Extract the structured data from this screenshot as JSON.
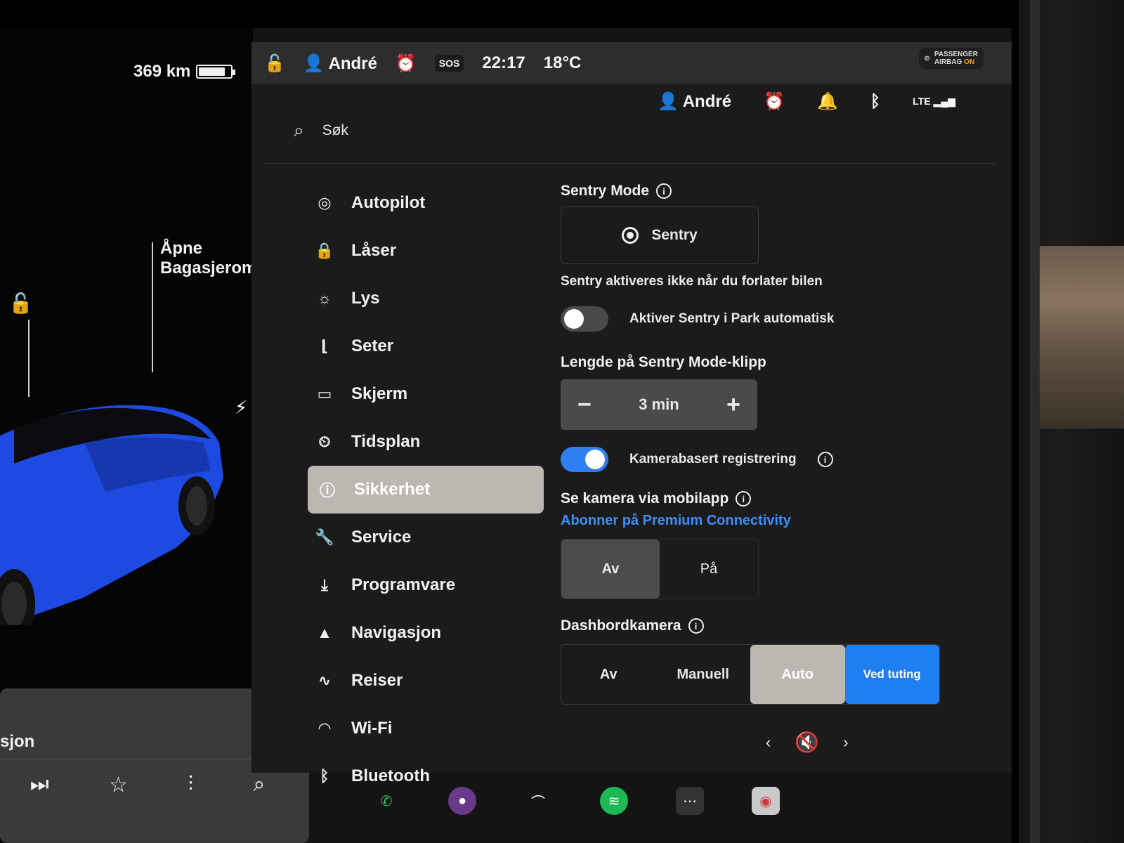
{
  "colors": {
    "accent": "#2f7ff0",
    "alarm": "#f0a020",
    "selected_tile": "#bdb7b1"
  },
  "car": {
    "range": "369 km",
    "battery_fraction": 0.85,
    "trunk_label_line1": "Åpne",
    "trunk_label_line2": "Bagasjerom",
    "icons": [
      "unlock-icon",
      "charge-bolt-icon"
    ]
  },
  "media": {
    "title": "sjon",
    "controls": [
      "skip-next-icon",
      "star-icon",
      "equalizer-icon",
      "search-icon"
    ]
  },
  "status_bar": {
    "user": "André",
    "sos": "SOS",
    "time": "22:17",
    "temperature": "18°C",
    "airbag_line1": "PASSENGER",
    "airbag_line2": "AIRBAG",
    "airbag_state": "ON"
  },
  "header": {
    "user": "André",
    "icons": [
      "alarm-icon",
      "bell-icon",
      "bluetooth-icon",
      "signal-icon"
    ],
    "network": "LTE"
  },
  "search": {
    "placeholder": "Søk"
  },
  "menu": {
    "items": [
      {
        "label": "Autopilot",
        "icon": "steering-wheel-icon"
      },
      {
        "label": "Låser",
        "icon": "lock-icon"
      },
      {
        "label": "Lys",
        "icon": "light-icon"
      },
      {
        "label": "Seter",
        "icon": "seat-icon"
      },
      {
        "label": "Skjerm",
        "icon": "display-icon"
      },
      {
        "label": "Tidsplan",
        "icon": "schedule-icon"
      },
      {
        "label": "Sikkerhet",
        "icon": "security-icon",
        "active": true
      },
      {
        "label": "Service",
        "icon": "wrench-icon"
      },
      {
        "label": "Programvare",
        "icon": "download-icon"
      },
      {
        "label": "Navigasjon",
        "icon": "navigation-icon"
      },
      {
        "label": "Reiser",
        "icon": "trips-icon"
      },
      {
        "label": "Wi-Fi",
        "icon": "wifi-icon"
      },
      {
        "label": "Bluetooth",
        "icon": "bluetooth-icon"
      }
    ]
  },
  "sentry": {
    "title": "Sentry Mode",
    "button_label": "Sentry",
    "note": "Sentry aktiveres ikke når du forlater bilen",
    "auto_park_label": "Aktiver Sentry i Park automatisk",
    "auto_park_on": false,
    "clip_length_label": "Lengde på Sentry Mode-klipp",
    "clip_length_value": "3 min",
    "camera_detection_label": "Kamerabasert registrering",
    "camera_detection_on": true,
    "mobile_view_label": "Se kamera via mobilapp",
    "premium_link": "Abonner på Premium Connectivity",
    "mobile_options": [
      "Av",
      "På"
    ],
    "mobile_selected": "Av"
  },
  "dashcam": {
    "title": "Dashbordkamera",
    "options": [
      "Av",
      "Manuell",
      "Auto",
      "Ved tuting"
    ],
    "selected": "Auto"
  },
  "dock": {
    "apps": [
      "phone-icon",
      "camera-app-icon",
      "wiper-icon",
      "spotify-icon",
      "more-icon",
      "dashcam-app-icon"
    ],
    "volume_icon": "mute-icon"
  }
}
